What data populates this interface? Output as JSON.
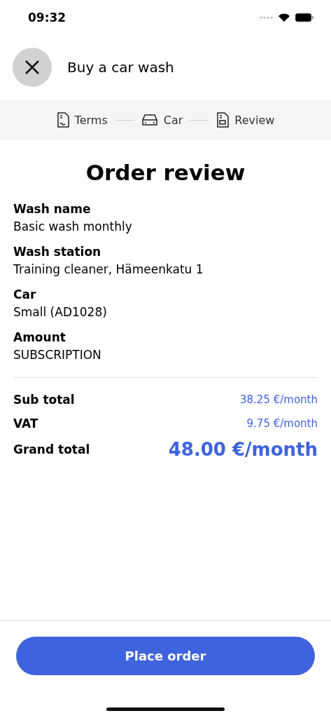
{
  "status_bar": {
    "time": "09:32"
  },
  "header": {
    "title": "Buy a car wash"
  },
  "steps": [
    {
      "kind": "terms",
      "label": "Terms"
    },
    {
      "kind": "car",
      "label": "Car"
    },
    {
      "kind": "review",
      "label": "Review"
    }
  ],
  "title": "Order review",
  "details": [
    {
      "label": "Wash name",
      "value": "Basic wash monthly"
    },
    {
      "label": "Wash station",
      "value": "Training cleaner, Hämeenkatu 1"
    },
    {
      "label": "Car",
      "value": "Small (AD1028)"
    },
    {
      "label": "Amount",
      "value": "SUBSCRIPTION"
    }
  ],
  "totals": [
    {
      "kind": "line",
      "label": "Sub total",
      "value": "38.25 €/month"
    },
    {
      "kind": "line",
      "label": "VAT",
      "value": "9.75 €/month"
    },
    {
      "kind": "grand",
      "label": "Grand total",
      "value": "48.00 €/month"
    }
  ],
  "button": "Place order"
}
